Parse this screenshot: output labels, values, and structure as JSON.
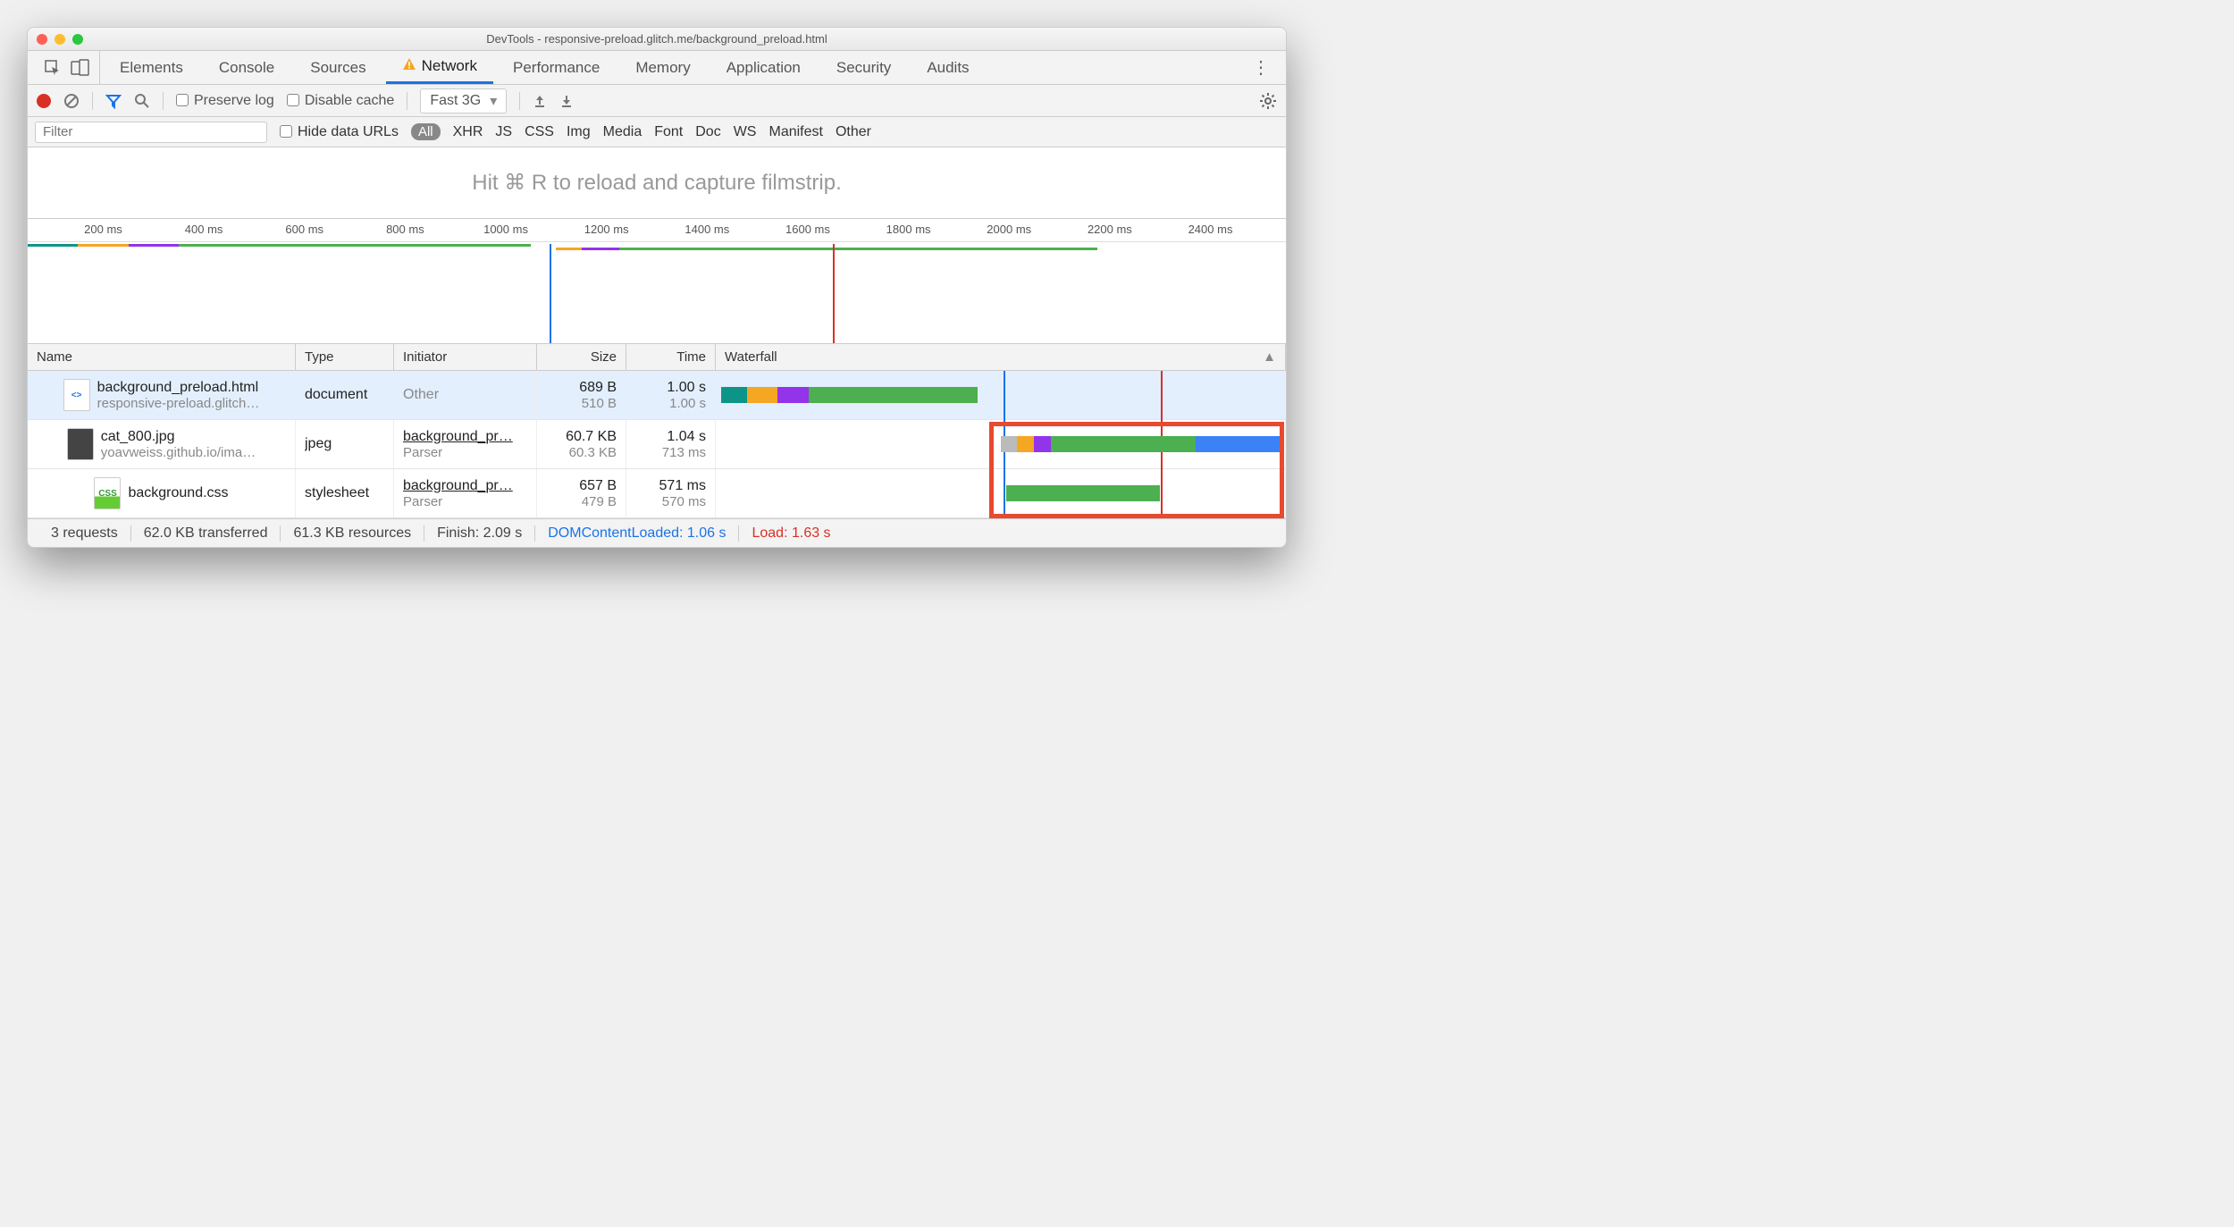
{
  "title": "DevTools - responsive-preload.glitch.me/background_preload.html",
  "mainTabs": [
    "Elements",
    "Console",
    "Sources",
    "Network",
    "Performance",
    "Memory",
    "Application",
    "Security",
    "Audits"
  ],
  "mainTabActive": "Network",
  "toolbar": {
    "preserve_log": "Preserve log",
    "disable_cache": "Disable cache",
    "throttle": "Fast 3G"
  },
  "filter": {
    "placeholder": "Filter",
    "hide_urls": "Hide data URLs",
    "all": "All",
    "types": [
      "XHR",
      "JS",
      "CSS",
      "Img",
      "Media",
      "Font",
      "Doc",
      "WS",
      "Manifest",
      "Other"
    ]
  },
  "hint": "Hit ⌘ R to reload and capture filmstrip.",
  "overview_ticks": [
    "200 ms",
    "400 ms",
    "600 ms",
    "800 ms",
    "1000 ms",
    "1200 ms",
    "1400 ms",
    "1600 ms",
    "1800 ms",
    "2000 ms",
    "2200 ms",
    "2400 ms"
  ],
  "columns": {
    "name": "Name",
    "type": "Type",
    "initiator": "Initiator",
    "size": "Size",
    "time": "Time",
    "waterfall": "Waterfall"
  },
  "rows": [
    {
      "name": "background_preload.html",
      "sub": "responsive-preload.glitch…",
      "type": "document",
      "init": "Other",
      "init_sub": "",
      "size": "689 B",
      "size_sub": "510 B",
      "time": "1.00 s",
      "time_sub": "1.00 s",
      "icon": "html"
    },
    {
      "name": "cat_800.jpg",
      "sub": "yoavweiss.github.io/ima…",
      "type": "jpeg",
      "init": "background_pr…",
      "init_sub": "Parser",
      "size": "60.7 KB",
      "size_sub": "60.3 KB",
      "time": "1.04 s",
      "time_sub": "713 ms",
      "icon": "img"
    },
    {
      "name": "background.css",
      "sub": "",
      "type": "stylesheet",
      "init": "background_pr…",
      "init_sub": "Parser",
      "size": "657 B",
      "size_sub": "479 B",
      "time": "571 ms",
      "time_sub": "570 ms",
      "icon": "css"
    }
  ],
  "status": {
    "requests": "3 requests",
    "transferred": "62.0 KB transferred",
    "resources": "61.3 KB resources",
    "finish": "Finish: 2.09 s",
    "dcl": "DOMContentLoaded: 1.06 s",
    "load": "Load: 1.63 s"
  }
}
